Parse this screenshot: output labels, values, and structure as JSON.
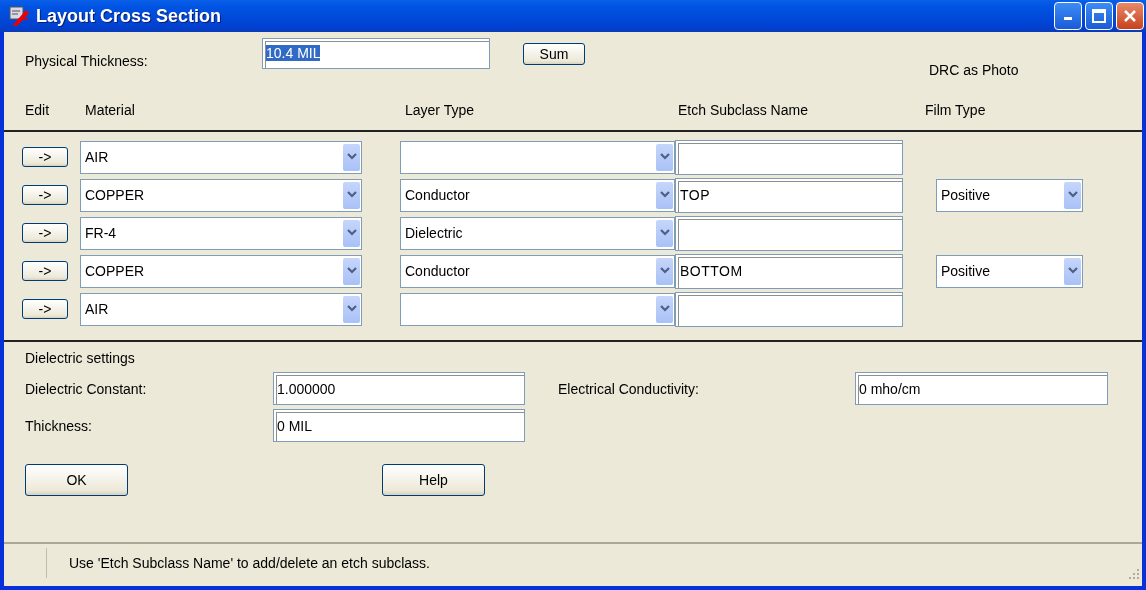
{
  "window": {
    "title": "Layout Cross Section"
  },
  "physical_thickness": {
    "label": "Physical Thickness:",
    "value": "10.4 MIL",
    "text_selected": true
  },
  "sum_button": "Sum",
  "drc_note": "DRC as Photo",
  "columns": [
    "Edit",
    "Material",
    "Layer Type",
    "Etch Subclass Name",
    "Film Type"
  ],
  "layers": [
    {
      "edit_button": "->",
      "material": "AIR"
    },
    {
      "edit_button": "->",
      "material": "COPPER",
      "layer_type": "Conductor",
      "etch_subclass": "TOP",
      "film_type": "Positive"
    },
    {
      "edit_button": "->",
      "material": "FR-4",
      "layer_type": "Dielectric"
    },
    {
      "edit_button": "->",
      "material": "COPPER",
      "layer_type": "Conductor",
      "etch_subclass": "BOTTOM",
      "film_type": "Positive"
    },
    {
      "edit_button": "->",
      "material": "AIR"
    }
  ],
  "dielectric_settings": {
    "heading": "Dielectric settings",
    "constant": {
      "label": "Dielectric Constant:",
      "value": "1.000000"
    },
    "conductivity": {
      "label": "Electrical Conductivity:",
      "value": "0 mho/cm"
    },
    "thickness": {
      "label": "Thickness:",
      "value": "0 MIL"
    }
  },
  "buttons": [
    "OK",
    "Help"
  ],
  "status_bar": "Use 'Etch Subclass Name' to add/delete an etch subclass."
}
